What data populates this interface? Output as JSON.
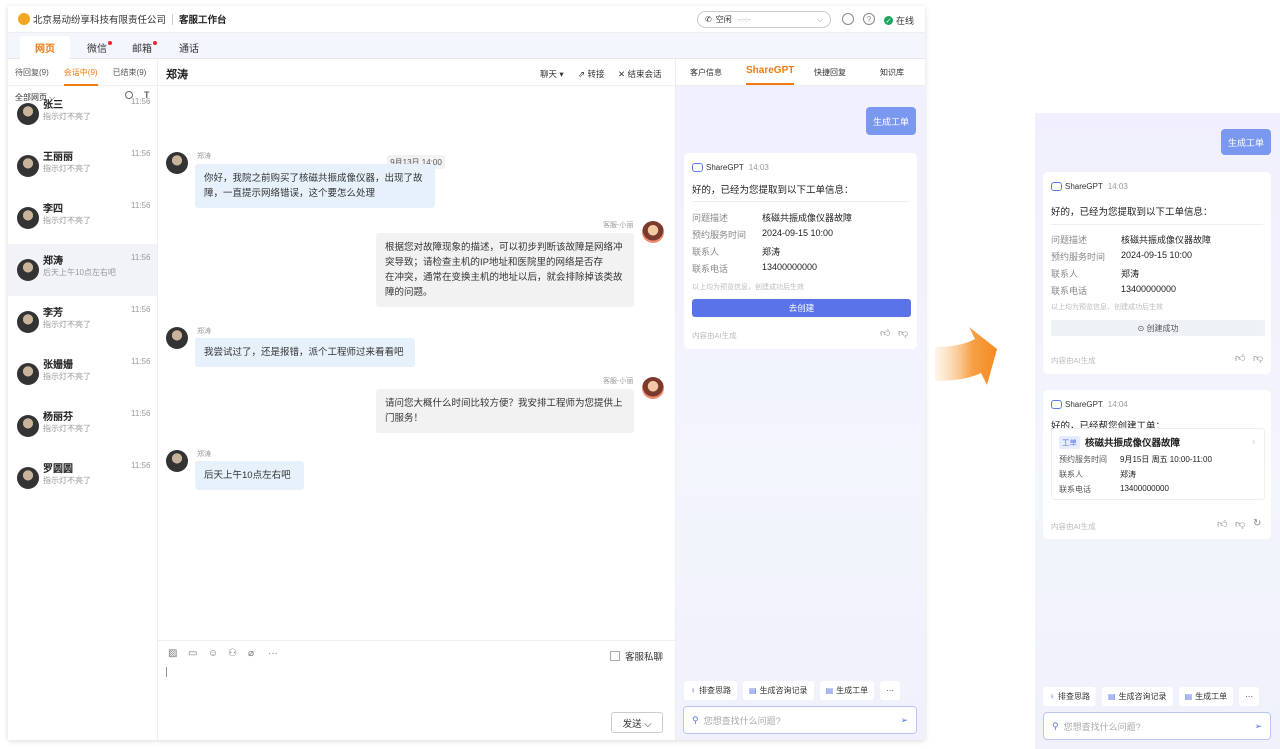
{
  "topbar": {
    "company": "北京易动纷享科技有限责任公司",
    "workbench": "客服工作台",
    "status": "空闲",
    "status_time": "--:--:--",
    "online": "在线"
  },
  "tabs": [
    {
      "label": "网页",
      "active": true,
      "dot": false
    },
    {
      "label": "微信",
      "active": false,
      "dot": true
    },
    {
      "label": "邮箱",
      "active": false,
      "dot": true
    },
    {
      "label": "通话",
      "active": false,
      "dot": false
    }
  ],
  "sublist": {
    "tabs": [
      "待回复(9)",
      "会话中(9)",
      "已结束(9)"
    ],
    "filter": "全部网页"
  },
  "contacts": [
    {
      "name": "张三",
      "time": "11:56",
      "msg": "指示灯不亮了"
    },
    {
      "name": "王丽丽",
      "time": "11:56",
      "msg": "指示灯不亮了"
    },
    {
      "name": "李四",
      "time": "11:56",
      "msg": "指示灯不亮了"
    },
    {
      "name": "郑涛",
      "time": "11:56",
      "msg": "后天上午10点左右吧"
    },
    {
      "name": "李芳",
      "time": "11:56",
      "msg": "指示灯不亮了"
    },
    {
      "name": "张姗姗",
      "time": "11:56",
      "msg": "指示灯不亮了"
    },
    {
      "name": "杨丽芬",
      "time": "11:56",
      "msg": "指示灯不亮了"
    },
    {
      "name": "罗圆圆",
      "time": "11:56",
      "msg": "指示灯不亮了"
    }
  ],
  "chat": {
    "title": "郑涛",
    "actions": {
      "chat": "聊天 ▾",
      "transfer": "⇗ 转接",
      "end": "✕ 结束会话"
    },
    "date": "9月13日 14:00",
    "messages": [
      {
        "sender": "郑涛",
        "lines": [
          "你好，我院之前购买了核磁共振成像仪器，出现了故",
          "障，一直提示网络错误，这个要怎么处理"
        ]
      },
      {
        "sender": "客服-小丽",
        "lines": [
          "根据您对故障现象的描述，可以初步判断该故障是网络冲",
          "突导致；请检查主机的IP地址和医院里的网络是否存",
          "在冲突，通常在变换主机的地址以后，就会排除掉该类故",
          "障的问题。"
        ]
      },
      {
        "sender": "郑涛",
        "lines": [
          "我尝试过了，还是报错，派个工程师过来看看吧"
        ]
      },
      {
        "sender": "客服-小丽",
        "lines": [
          "请问您大概什么时间比较方便？我安排工程师为您提供上",
          "门服务！"
        ]
      },
      {
        "sender": "郑涛",
        "lines": [
          "后天上午10点左右吧"
        ]
      }
    ],
    "private": "客服私聊",
    "send": "发送 ⌵"
  },
  "right": {
    "tabs": [
      "客户信息",
      "ShareGPT",
      "快捷回复",
      "知识库"
    ],
    "gen_btn": "生成工单",
    "card1": {
      "bot": "ShareGPT",
      "time": "14:03",
      "msg": "好的，已经为您提取到以下工单信息：",
      "fields": [
        {
          "k": "问题描述",
          "v": "核磁共振成像仪器故障"
        },
        {
          "k": "预约服务时间",
          "v": "2024-09-15  10:00"
        },
        {
          "k": "联系人",
          "v": "郑涛"
        },
        {
          "k": "联系电话",
          "v": "13400000000"
        }
      ],
      "note": "以上均为预览信息，创建成功后生效",
      "go": "去创建",
      "done": "⊙ 创建成功",
      "ai": "内容由AI生成"
    },
    "card2": {
      "bot": "ShareGPT",
      "time": "14:04",
      "msg": "好的，已经帮您创建工单：",
      "tag": "工单",
      "title": "核磁共振成像仪器故障",
      "fields": [
        {
          "k": "预约服务时间",
          "v": "9月15日 周五 10:00-11:00"
        },
        {
          "k": "联系人",
          "v": "郑涛"
        },
        {
          "k": "联系电话",
          "v": "13400000000"
        }
      ],
      "ai": "内容由AI生成"
    },
    "chips": [
      "排查思路",
      "生成咨询记录",
      "生成工单"
    ],
    "more": "···",
    "ask_placeholder": "您想查找什么问题?"
  }
}
